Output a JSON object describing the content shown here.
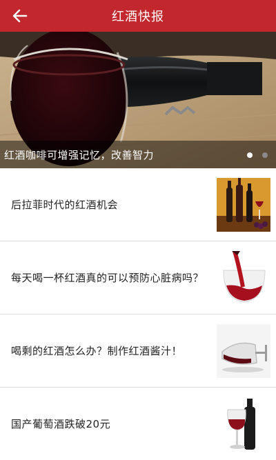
{
  "header": {
    "title": "红酒快报",
    "back_icon": "arrow-left-icon",
    "color": "#c2272d"
  },
  "banner": {
    "caption": "红酒咖啡可增强记忆，改善智力",
    "slide_count": 2,
    "active_slide": 1
  },
  "news": [
    {
      "title": "后拉菲时代的红酒机会"
    },
    {
      "title": "每天喝一杯红酒真的可以预防心脏病吗？"
    },
    {
      "title": "喝剩的红酒怎么办？制作红酒酱汁！"
    },
    {
      "title": "国产葡萄酒跌破20元"
    }
  ]
}
